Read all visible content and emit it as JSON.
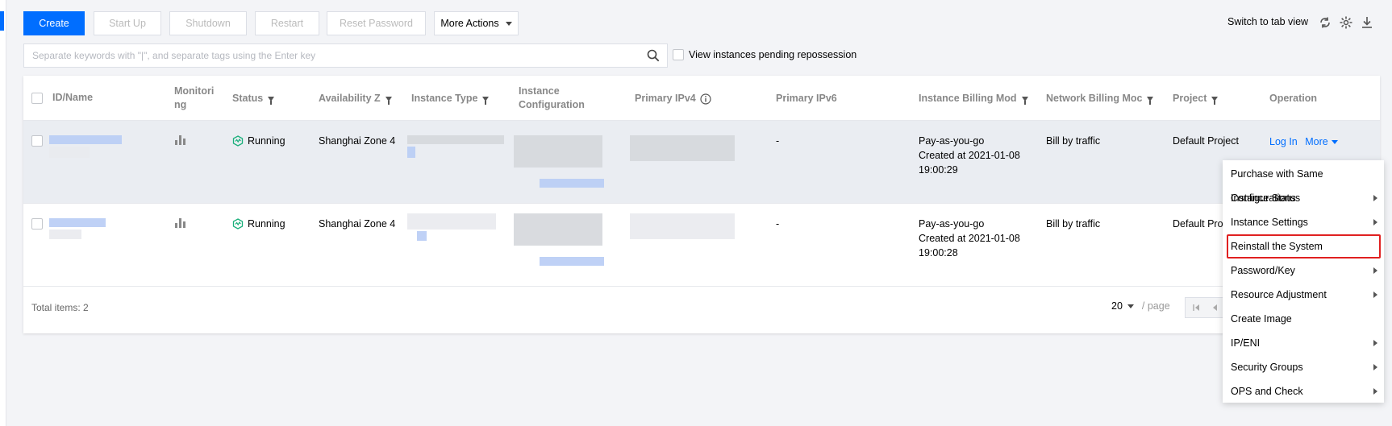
{
  "toolbar": {
    "create": "Create",
    "start_up": "Start Up",
    "shutdown": "Shutdown",
    "restart": "Restart",
    "reset_password": "Reset Password",
    "more_actions": "More Actions",
    "switch_view": "Switch to tab view"
  },
  "search": {
    "placeholder": "Separate keywords with \"|\", and separate tags using the Enter key",
    "pending_label": "View instances pending repossession"
  },
  "table": {
    "headers": {
      "id_name": "ID/Name",
      "monitoring": "Monitori ng",
      "status": "Status",
      "availability_zone": "Availability Z",
      "instance_type": "Instance Type",
      "instance_configuration": "Instance Configuration",
      "primary_ipv4": "Primary IPv4",
      "primary_ipv6": "Primary IPv6",
      "instance_billing_mode": "Instance Billing Mod",
      "network_billing_mode": "Network Billing Moc",
      "project": "Project",
      "operation": "Operation"
    },
    "rows": [
      {
        "status": "Running",
        "zone": "Shanghai Zone 4",
        "ipv6": "-",
        "billing_1": "Pay-as-you-go",
        "billing_2": "Created at 2021-01-08",
        "billing_3": "19:00:29",
        "network_billing": "Bill by traffic",
        "project": "Default Project",
        "login": "Log In",
        "more": "More"
      },
      {
        "status": "Running",
        "zone": "Shanghai Zone 4",
        "ipv6": "-",
        "billing_1": "Pay-as-you-go",
        "billing_2": "Created at 2021-01-08",
        "billing_3": "19:00:28",
        "network_billing": "Bill by traffic",
        "project": "Default Proj"
      }
    ],
    "footer": {
      "total_label": "Total items:",
      "total_count": "2",
      "page_size": "20",
      "per_page": "/ page"
    }
  },
  "menu": {
    "items": [
      "Purchase with Same Configurations",
      "Instance Status",
      "Instance Settings",
      "Reinstall the System",
      "Password/Key",
      "Resource Adjustment",
      "Create Image",
      "IP/ENI",
      "Security Groups",
      "OPS and Check"
    ]
  },
  "colors": {
    "accent": "#006eff",
    "status_running": "#1aaf7b",
    "highlight_border": "#e02020"
  }
}
